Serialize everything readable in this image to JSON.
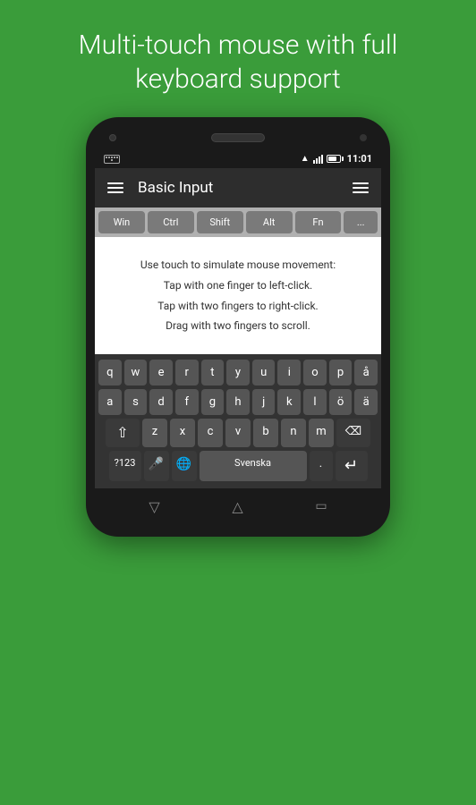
{
  "headline": "Multi-touch mouse with full keyboard support",
  "phone": {
    "status_bar": {
      "time": "11:01"
    },
    "toolbar": {
      "title": "Basic Input",
      "menu_icon": "≡"
    },
    "modifier_keys": [
      "Win",
      "Ctrl",
      "Shift",
      "Alt",
      "Fn",
      "..."
    ],
    "content": {
      "line1": "Use touch to simulate mouse movement:",
      "line2": "Tap with one finger to left-click.",
      "line3": "Tap with two fingers to right-click.",
      "line4": "Drag with two fingers to scroll."
    },
    "keyboard": {
      "row1": [
        "q",
        "w",
        "e",
        "r",
        "t",
        "y",
        "u",
        "i",
        "o",
        "p",
        "å"
      ],
      "row2": [
        "a",
        "s",
        "d",
        "f",
        "g",
        "h",
        "j",
        "k",
        "l",
        "ö",
        "ä"
      ],
      "row3_special_left": "⇧",
      "row3": [
        "z",
        "x",
        "c",
        "v",
        "b",
        "n",
        "m"
      ],
      "row3_special_right": "⌫",
      "row4_num": "?123",
      "row4_mic": "🎤",
      "row4_globe": "🌐",
      "row4_space": "Svenska",
      "row4_period": ".",
      "row4_enter": "↵"
    },
    "nav": {
      "back": "▽",
      "home": "△",
      "recent": "▭"
    }
  }
}
